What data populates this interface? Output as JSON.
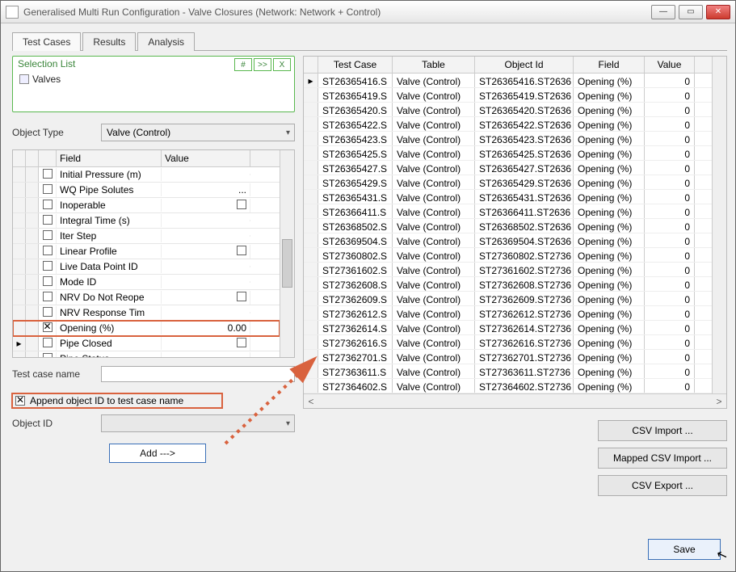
{
  "window": {
    "title": "Generalised Multi Run Configuration  - Valve Closures (Network: Network + Control)"
  },
  "tabs": [
    "Test Cases",
    "Results",
    "Analysis"
  ],
  "active_tab": 0,
  "selection_list": {
    "label": "Selection List",
    "btn_hash": "#",
    "btn_next": ">>",
    "btn_close": "X",
    "item": "Valves"
  },
  "object_type": {
    "label": "Object Type",
    "value": "Valve (Control)"
  },
  "field_grid": {
    "headers": {
      "field": "Field",
      "value": "Value"
    },
    "rows": [
      {
        "checked": false,
        "field": "Initial Pressure (m)",
        "value": ""
      },
      {
        "checked": false,
        "field": "WQ Pipe Solutes",
        "value": "...",
        "val_align": "right"
      },
      {
        "checked": false,
        "field": "Inoperable",
        "value": "cb"
      },
      {
        "checked": false,
        "field": "Integral Time (s)",
        "value": ""
      },
      {
        "checked": false,
        "field": "Iter Step",
        "value": ""
      },
      {
        "checked": false,
        "field": "Linear Profile",
        "value": "cb"
      },
      {
        "checked": false,
        "field": "Live Data Point ID",
        "value": ""
      },
      {
        "checked": false,
        "field": "Mode ID",
        "value": ""
      },
      {
        "checked": false,
        "field": "NRV Do Not Reope",
        "value": "cb"
      },
      {
        "checked": false,
        "field": "NRV Response Tim",
        "value": ""
      },
      {
        "checked": true,
        "field": "Opening (%)",
        "value": "0.00",
        "highlight": true
      },
      {
        "checked": false,
        "field": "Pipe Closed",
        "value": "cb",
        "indicator": "▸"
      },
      {
        "checked": false,
        "field": "Pipe Status",
        "value": "...",
        "val_align": "right"
      }
    ]
  },
  "test_case_name": {
    "label": "Test case name",
    "value": ""
  },
  "append_checkbox": {
    "label": "Append object ID to test case name",
    "checked": true,
    "highlight": true
  },
  "object_id": {
    "label": "Object ID",
    "value": ""
  },
  "add_button": "Add --->",
  "big_grid": {
    "headers": {
      "tc": "Test Case",
      "tb": "Table",
      "oi": "Object Id",
      "fd": "Field",
      "vl": "Value"
    },
    "rows": [
      {
        "ind": "▸",
        "tc": "ST26365416.S",
        "tb": "Valve (Control)",
        "oi": "ST26365416.ST2636",
        "fd": "Opening (%)",
        "vl": "0"
      },
      {
        "tc": "ST26365419.S",
        "tb": "Valve (Control)",
        "oi": "ST26365419.ST2636",
        "fd": "Opening (%)",
        "vl": "0"
      },
      {
        "tc": "ST26365420.S",
        "tb": "Valve (Control)",
        "oi": "ST26365420.ST2636",
        "fd": "Opening (%)",
        "vl": "0"
      },
      {
        "tc": "ST26365422.S",
        "tb": "Valve (Control)",
        "oi": "ST26365422.ST2636",
        "fd": "Opening (%)",
        "vl": "0"
      },
      {
        "tc": "ST26365423.S",
        "tb": "Valve (Control)",
        "oi": "ST26365423.ST2636",
        "fd": "Opening (%)",
        "vl": "0"
      },
      {
        "tc": "ST26365425.S",
        "tb": "Valve (Control)",
        "oi": "ST26365425.ST2636",
        "fd": "Opening (%)",
        "vl": "0"
      },
      {
        "tc": "ST26365427.S",
        "tb": "Valve (Control)",
        "oi": "ST26365427.ST2636",
        "fd": "Opening (%)",
        "vl": "0"
      },
      {
        "tc": "ST26365429.S",
        "tb": "Valve (Control)",
        "oi": "ST26365429.ST2636",
        "fd": "Opening (%)",
        "vl": "0"
      },
      {
        "tc": "ST26365431.S",
        "tb": "Valve (Control)",
        "oi": "ST26365431.ST2636",
        "fd": "Opening (%)",
        "vl": "0"
      },
      {
        "tc": "ST26366411.S",
        "tb": "Valve (Control)",
        "oi": "ST26366411.ST2636",
        "fd": "Opening (%)",
        "vl": "0"
      },
      {
        "tc": "ST26368502.S",
        "tb": "Valve (Control)",
        "oi": "ST26368502.ST2636",
        "fd": "Opening (%)",
        "vl": "0"
      },
      {
        "tc": "ST26369504.S",
        "tb": "Valve (Control)",
        "oi": "ST26369504.ST2636",
        "fd": "Opening (%)",
        "vl": "0"
      },
      {
        "tc": "ST27360802.S",
        "tb": "Valve (Control)",
        "oi": "ST27360802.ST2736",
        "fd": "Opening (%)",
        "vl": "0"
      },
      {
        "tc": "ST27361602.S",
        "tb": "Valve (Control)",
        "oi": "ST27361602.ST2736",
        "fd": "Opening (%)",
        "vl": "0"
      },
      {
        "tc": "ST27362608.S",
        "tb": "Valve (Control)",
        "oi": "ST27362608.ST2736",
        "fd": "Opening (%)",
        "vl": "0"
      },
      {
        "tc": "ST27362609.S",
        "tb": "Valve (Control)",
        "oi": "ST27362609.ST2736",
        "fd": "Opening (%)",
        "vl": "0"
      },
      {
        "tc": "ST27362612.S",
        "tb": "Valve (Control)",
        "oi": "ST27362612.ST2736",
        "fd": "Opening (%)",
        "vl": "0"
      },
      {
        "tc": "ST27362614.S",
        "tb": "Valve (Control)",
        "oi": "ST27362614.ST2736",
        "fd": "Opening (%)",
        "vl": "0"
      },
      {
        "tc": "ST27362616.S",
        "tb": "Valve (Control)",
        "oi": "ST27362616.ST2736",
        "fd": "Opening (%)",
        "vl": "0"
      },
      {
        "tc": "ST27362701.S",
        "tb": "Valve (Control)",
        "oi": "ST27362701.ST2736",
        "fd": "Opening (%)",
        "vl": "0"
      },
      {
        "tc": "ST27363611.S",
        "tb": "Valve (Control)",
        "oi": "ST27363611.ST2736",
        "fd": "Opening (%)",
        "vl": "0"
      },
      {
        "tc": "ST27364602.S",
        "tb": "Valve (Control)",
        "oi": "ST27364602.ST2736",
        "fd": "Opening (%)",
        "vl": "0"
      }
    ]
  },
  "right_buttons": {
    "csv_import": "CSV Import ...",
    "mapped_import": "Mapped CSV Import ...",
    "csv_export": "CSV Export ..."
  },
  "save_button": "Save"
}
